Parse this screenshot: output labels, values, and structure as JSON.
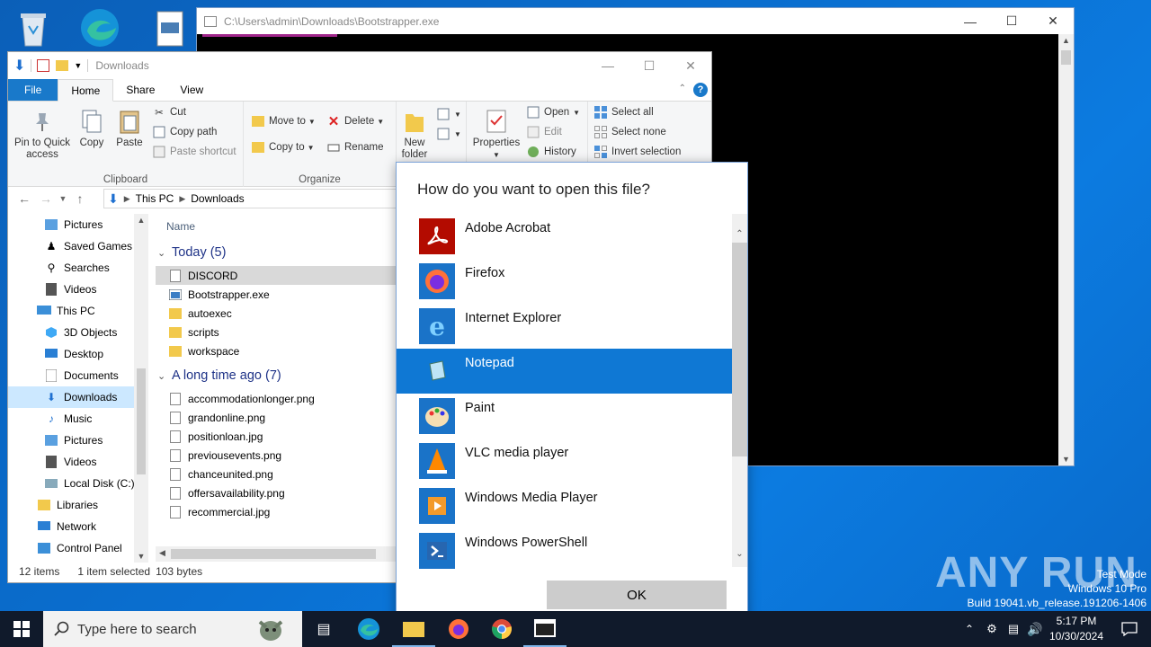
{
  "desktop": {
    "icons": [
      "recycle-bin-icon",
      "edge-icon",
      "file-icon"
    ]
  },
  "console": {
    "title": "C:\\Users\\admin\\Downloads\\Bootstrapper.exe"
  },
  "explorer": {
    "title": "Downloads",
    "tabs": {
      "file": "File",
      "home": "Home",
      "share": "Share",
      "view": "View"
    },
    "ribbon": {
      "pin_quick_access": "Pin to Quick access",
      "copy": "Copy",
      "paste": "Paste",
      "cut": "Cut",
      "copy_path": "Copy path",
      "paste_shortcut": "Paste shortcut",
      "clipboard_group": "Clipboard",
      "move_to": "Move to",
      "copy_to": "Copy to",
      "delete": "Delete",
      "rename": "Rename",
      "organize_group": "Organize",
      "new_folder": "New folder",
      "properties": "Properties",
      "open": "Open",
      "edit": "Edit",
      "history": "History",
      "select_all": "Select all",
      "select_none": "Select none",
      "invert_selection": "Invert selection"
    },
    "address": {
      "this_pc": "This PC",
      "downloads": "Downloads"
    },
    "nav_items": [
      {
        "label": "Pictures",
        "icon": "pictures-icon"
      },
      {
        "label": "Saved Games",
        "icon": "saved-games-icon"
      },
      {
        "label": "Searches",
        "icon": "searches-icon"
      },
      {
        "label": "Videos",
        "icon": "videos-icon"
      },
      {
        "label": "This PC",
        "icon": "this-pc-icon"
      },
      {
        "label": "3D Objects",
        "icon": "3d-objects-icon"
      },
      {
        "label": "Desktop",
        "icon": "desktop-icon"
      },
      {
        "label": "Documents",
        "icon": "documents-icon"
      },
      {
        "label": "Downloads",
        "icon": "downloads-icon"
      },
      {
        "label": "Music",
        "icon": "music-icon"
      },
      {
        "label": "Pictures",
        "icon": "pictures-icon"
      },
      {
        "label": "Videos",
        "icon": "videos-icon"
      },
      {
        "label": "Local Disk (C:)",
        "icon": "local-disk-icon"
      },
      {
        "label": "Libraries",
        "icon": "libraries-icon"
      },
      {
        "label": "Network",
        "icon": "network-icon"
      },
      {
        "label": "Control Panel",
        "icon": "control-panel-icon"
      }
    ],
    "column_name": "Name",
    "group_today": "Today (5)",
    "today_files": [
      "DISCORD",
      "Bootstrapper.exe",
      "autoexec",
      "scripts",
      "workspace"
    ],
    "group_old": "A long time ago (7)",
    "old_files": [
      "accommodationlonger.png",
      "grandonline.png",
      "positionloan.jpg",
      "previousevents.png",
      "chanceunited.png",
      "offersavailability.png",
      "recommercial.jpg"
    ],
    "status": {
      "items": "12 items",
      "selected": "1 item selected",
      "size": "103 bytes"
    }
  },
  "dialog": {
    "title": "How do you want to open this file?",
    "apps": [
      "Adobe Acrobat",
      "Firefox",
      "Internet Explorer",
      "Notepad",
      "Paint",
      "VLC media player",
      "Windows Media Player",
      "Windows PowerShell"
    ],
    "selected_app": "Notepad",
    "ok_label": "OK"
  },
  "taskbar": {
    "search_placeholder": "Type here to search",
    "time": "5:17 PM",
    "date": "10/30/2024"
  },
  "watermark": {
    "brand": "ANY RUN",
    "test_mode": "Test Mode",
    "os": "Windows 10 Pro",
    "build": "Build 19041.vb_release.191206-1406"
  },
  "colors": {
    "accent": "#0f78d4",
    "taskbar": "#101a2b",
    "desktop": "#0a6fd0"
  }
}
